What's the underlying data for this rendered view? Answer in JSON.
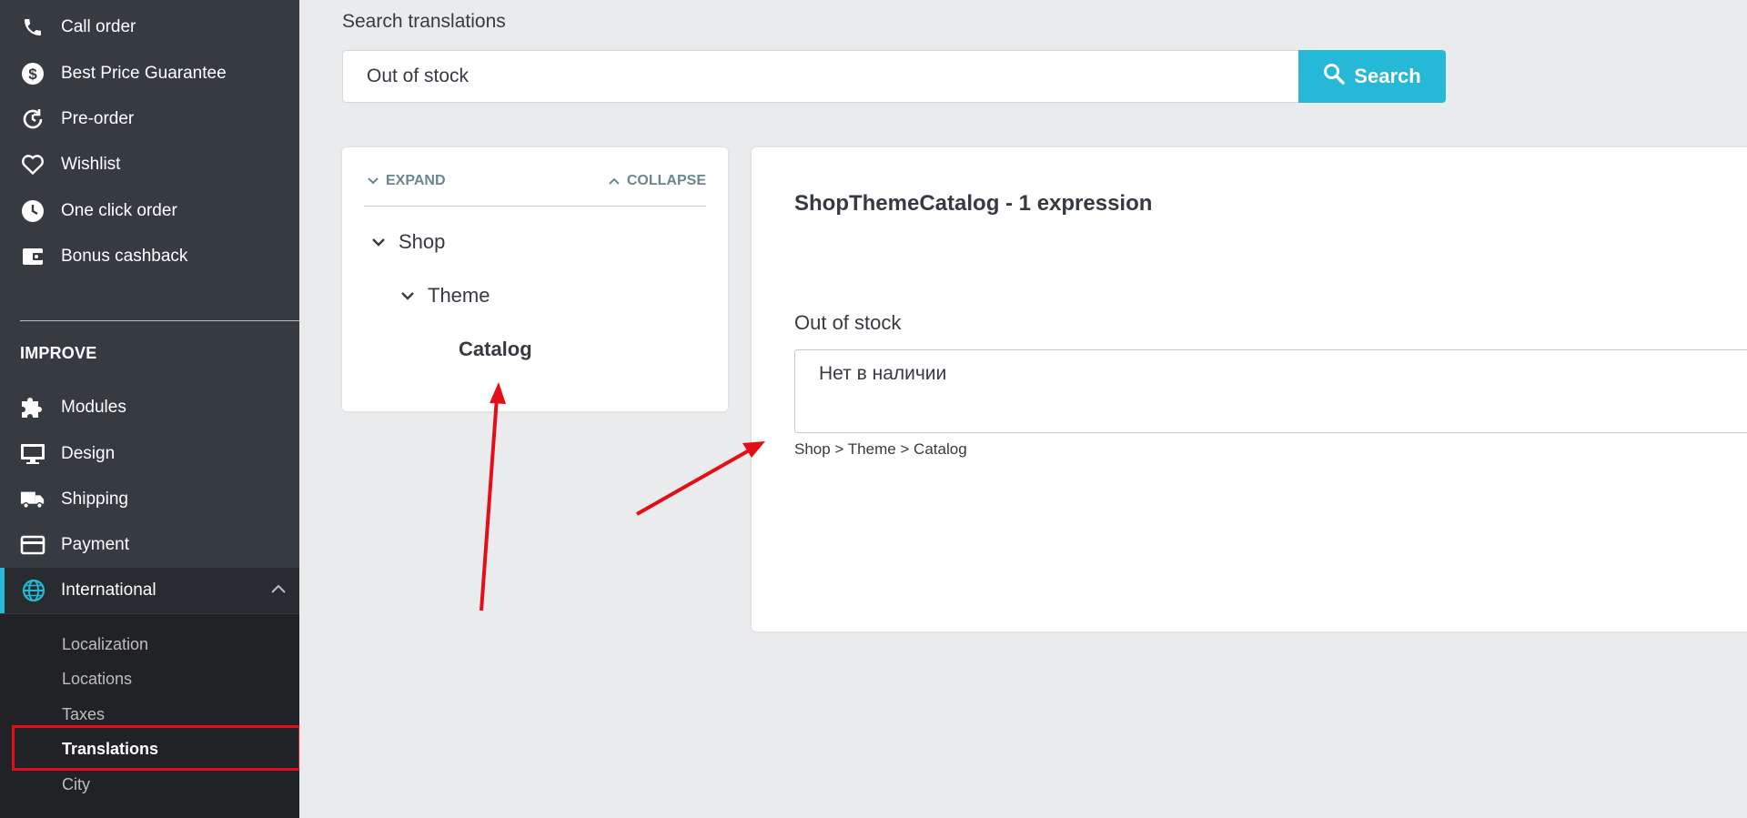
{
  "sidebar": {
    "items": [
      {
        "label": "Call order",
        "icon": "phone-icon"
      },
      {
        "label": "Best Price Guarantee",
        "icon": "dollar-circle-icon"
      },
      {
        "label": "Pre-order",
        "icon": "clock-refresh-icon"
      },
      {
        "label": "Wishlist",
        "icon": "heart-icon"
      },
      {
        "label": "One click order",
        "icon": "clock-icon"
      },
      {
        "label": "Bonus cashback",
        "icon": "wallet-icon"
      }
    ],
    "section_title": "IMPROVE",
    "improve_items": [
      {
        "label": "Modules",
        "icon": "puzzle-icon"
      },
      {
        "label": "Design",
        "icon": "monitor-icon"
      },
      {
        "label": "Shipping",
        "icon": "truck-icon"
      },
      {
        "label": "Payment",
        "icon": "credit-card-icon"
      },
      {
        "label": "International",
        "icon": "globe-icon",
        "active": true
      }
    ],
    "submenu": [
      "Localization",
      "Locations",
      "Taxes",
      "Translations",
      "City"
    ],
    "current_submenu": "Translations",
    "accent_color": "#25b9d7"
  },
  "search": {
    "label": "Search translations",
    "value": "Out of stock",
    "button_label": "Search"
  },
  "tree": {
    "expand_label": "EXPAND",
    "collapse_label": "COLLAPSE",
    "nodes": [
      {
        "label": "Shop",
        "level": 0
      },
      {
        "label": "Theme",
        "level": 1
      },
      {
        "label": "Catalog",
        "level": 2,
        "selected": true
      }
    ]
  },
  "detail": {
    "title": "ShopThemeCatalog - 1 expression",
    "field_label": "Out of stock",
    "field_value": "Нет в наличии",
    "field_path": "Shop > Theme > Catalog"
  },
  "annotation_color": "#e30e17"
}
